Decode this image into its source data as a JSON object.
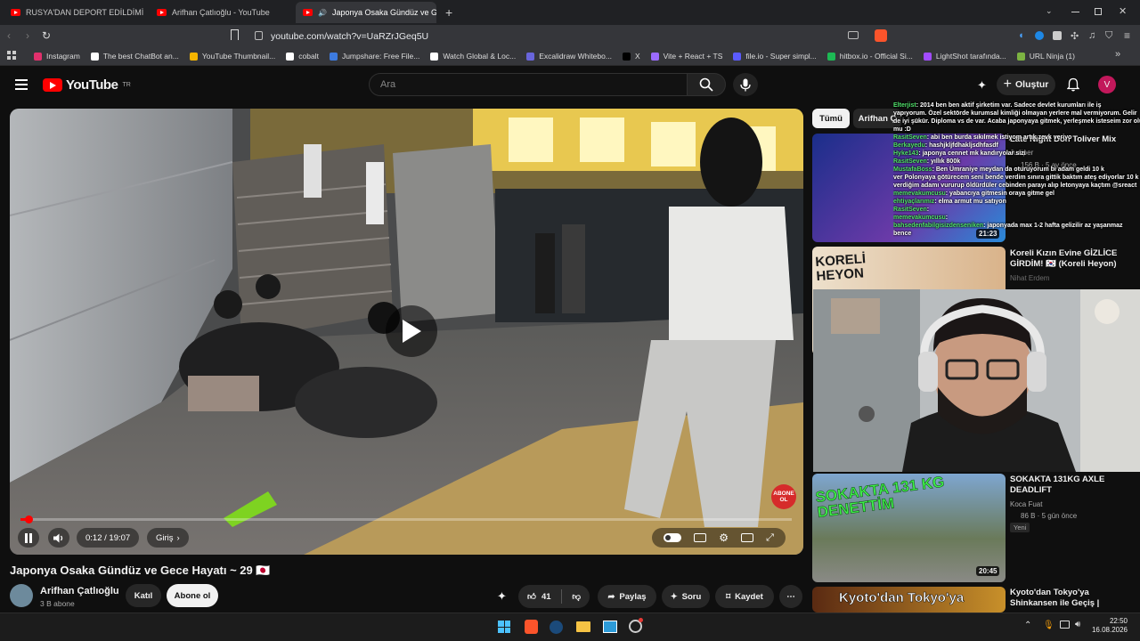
{
  "browser": {
    "tabs": [
      {
        "title": "RUSYA'DAN DEPORT EDİLDİMİ | Sınır",
        "active": false
      },
      {
        "title": "Arifhan Çatlıoğlu - YouTube",
        "active": false
      },
      {
        "title": "Japonya Osaka Gündüz ve Ge",
        "active": true
      }
    ],
    "url": "youtube.com/watch?v=UaRZrJGeq5U",
    "bookmarks": [
      {
        "label": "Instagram",
        "color": "#e1306c"
      },
      {
        "label": "The best ChatBot an...",
        "color": "#ffffff"
      },
      {
        "label": "YouTube Thumbnail...",
        "color": "#f4b400"
      },
      {
        "label": "cobalt",
        "color": "#ffffff"
      },
      {
        "label": "Jumpshare: Free File...",
        "color": "#3d7be0"
      },
      {
        "label": "Watch Global & Loc...",
        "color": "#ffffff"
      },
      {
        "label": "Excalidraw Whitebo...",
        "color": "#6965db"
      },
      {
        "label": "X",
        "color": "#000000"
      },
      {
        "label": "Vite + React + TS",
        "color": "#9b6bff"
      },
      {
        "label": "file.io - Super simpl...",
        "color": "#5b5bff"
      },
      {
        "label": "hitbox.io - Official Si...",
        "color": "#1db954"
      },
      {
        "label": "LightShot tarafında...",
        "color": "#a24cff"
      },
      {
        "label": "URL Ninja (1)",
        "color": "#7cb342"
      }
    ]
  },
  "header": {
    "logo_text": "YouTube",
    "logo_suffix": "TR",
    "search_placeholder": "Ara",
    "create_label": "Oluştur",
    "avatar_letter": "V"
  },
  "player": {
    "time": "0:12 / 19:07",
    "progress_fraction": 0.0105,
    "chapter": "Giriş",
    "watermark": "ABONE OL"
  },
  "video": {
    "title": "Japonya Osaka Gündüz ve Gece Hayatı ~ 29 🇯🇵",
    "channel": "Arifhan Çatlıoğlu",
    "subscribers": "3 B abone",
    "join_label": "Katıl",
    "subscribe_label": "Abone ol",
    "likes": "41",
    "share_label": "Paylaş",
    "ask_label": "Soru",
    "save_label": "Kaydet"
  },
  "sidebar": {
    "chips": [
      "Tümü",
      "Arifhan Ç"
    ],
    "videos": [
      {
        "title": "Late Night Don Toliver Mix",
        "channel": "Juniper",
        "meta": "156 B · 5 ay önce",
        "duration": "21:23",
        "colors": [
          "#2848a8",
          "#4a2b8f"
        ]
      },
      {
        "title": "Koreli Kızın Evine GİZLİCE GİRDİM! 🇰🇷 (Koreli Heyon)",
        "channel": "Nihat Erdem",
        "meta": "207 B · 11 gün önce",
        "duration": "",
        "colors": [
          "#e8d7c0",
          "#b84a3a"
        ]
      },
      {
        "title": "SOKAKTA 131KG AXLE DEADLIFT",
        "channel": "Koca Fuat",
        "meta": "86 B · 5 gün önce",
        "badge": "Yeni",
        "duration": "20:45",
        "colors": [
          "#6c8fb8",
          "#4f6b3a"
        ]
      },
      {
        "title": "Kyoto'dan Tokyo'ya Shinkansen ile Geçiş |",
        "channel": "",
        "meta": "",
        "duration": "",
        "colors": [
          "#d9a441",
          "#7a2c16"
        ]
      }
    ],
    "thumb_texts": {
      "v2": "KORELİ HEYON",
      "v3": "SOKAKTA 131 KG DENETTİM",
      "v4": "Kyoto'dan Tokyo'ya"
    }
  },
  "chat": [
    {
      "user": "Elterjist",
      "msg": "2014 ben ben aktif şirketim var. Sadece devlet kurumları ile iş"
    },
    {
      "user": "",
      "msg": "yapıyorum. Özel sektörde kurumsal kimliği olmayan yerlere mal vermiyorum. Gelir"
    },
    {
      "user": "",
      "msg": "de iyi şükür. Diploma vs de var. Acaba japonyaya gitmek, yerleşmek isteseim zor olur"
    },
    {
      "user": "",
      "msg": "mu :D"
    },
    {
      "user": "RasitSeven",
      "msg": "abi ben burda sıkılmek istiyom artık zevk veriyo"
    },
    {
      "user": "Berkayedu",
      "msg": "hashjkljfdhakljsdhfasdf"
    },
    {
      "user": "Hyke143",
      "msg": "japonya cennet mk kandıryolar sizi"
    },
    {
      "user": "RasitSeven",
      "msg": "yıllık 800k"
    },
    {
      "user": "MustafaBoss",
      "msg": "Ben Ümraniye meydan da oturuyorum bi adam geldi 10 k"
    },
    {
      "user": "",
      "msg": "ver Polonyaya götürecem seni bende verdim sınıra gittik baktım ateş ediyorlar 10 k"
    },
    {
      "user": "",
      "msg": "verdiğim adamı vururup öldürdüler cebinden parayı alıp letonyaya kaçtım @sreact"
    },
    {
      "user": "memevakumcusu",
      "msg": "yabancıya gitmesin oraya gitme gel"
    },
    {
      "user": "ehtiyaçlarımız",
      "msg": "elma armut mu satıyon"
    },
    {
      "user": "RasitSeven",
      "msg": ""
    },
    {
      "user": "memevakumcusu",
      "msg": ""
    },
    {
      "user": "bahsedenfabilgisizdenseniken",
      "msg": "japonyada max 1-2 hafta gelizilir az yaşanmaz"
    },
    {
      "user": "",
      "msg": "bence"
    }
  ],
  "taskbar": {
    "time": "22:50",
    "date": "16.08.2026"
  }
}
